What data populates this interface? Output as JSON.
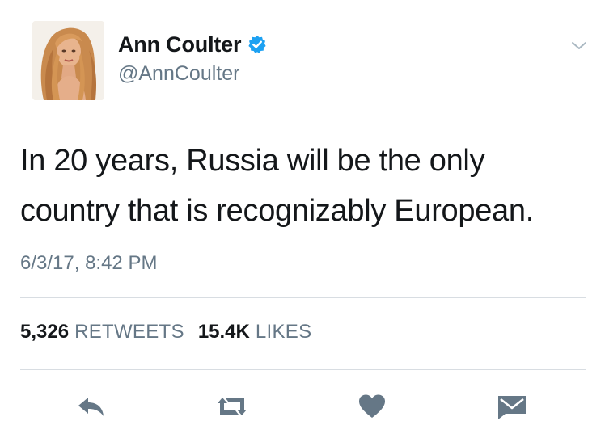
{
  "author": {
    "display_name": "Ann Coulter",
    "handle": "@AnnCoulter",
    "verified": true
  },
  "tweet": {
    "text_line_1": "In 20 years, Russia will be the only",
    "text_line_2": "country that is recognizably European.",
    "timestamp": "6/3/17, 8:42 PM"
  },
  "stats": {
    "retweets_count": "5,326",
    "retweets_label": "RETWEETS",
    "likes_count": "15.4K",
    "likes_label": "LIKES"
  },
  "icons": {
    "verified": "verified-badge-icon",
    "caret": "chevron-down-icon",
    "reply": "reply-icon",
    "retweet": "retweet-icon",
    "like": "heart-icon",
    "message": "envelope-icon"
  },
  "colors": {
    "text_primary": "#14171a",
    "text_secondary": "#657786",
    "verified_blue": "#1da1f2",
    "action_icon": "#657786",
    "divider": "#d8dde2"
  }
}
